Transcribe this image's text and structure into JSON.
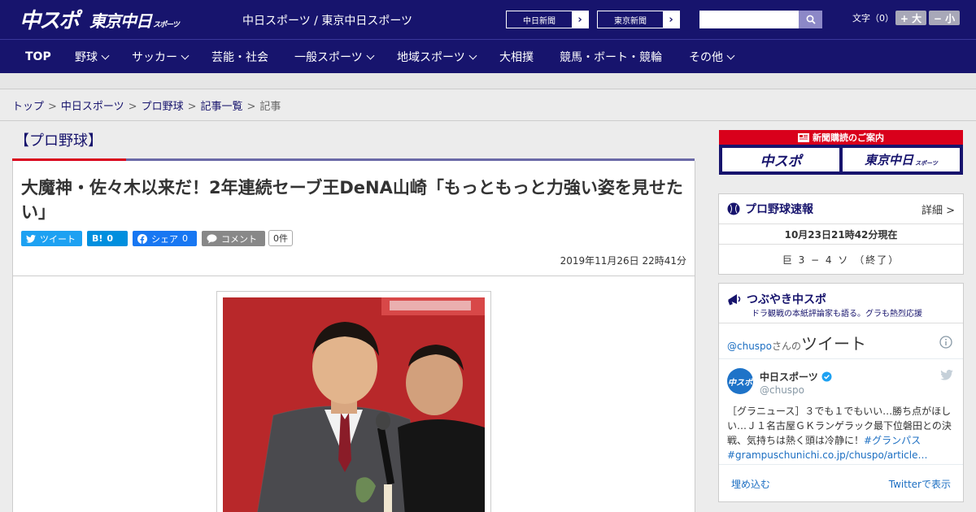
{
  "header": {
    "logo_main": "中スポ",
    "logo_tokyo": "東京中日",
    "logo_tokyo_sub": "スポーツ",
    "site_names": "中日スポーツ / 東京中日スポーツ",
    "paper_buttons": [
      "中日新聞",
      "東京新聞"
    ],
    "search_placeholder": "",
    "fontsize_label": "文字（0）",
    "fontsize_plus": "+ 大",
    "fontsize_minus": "− 小"
  },
  "nav": {
    "items": [
      {
        "label": "TOP",
        "dropdown": false
      },
      {
        "label": "野球",
        "dropdown": true
      },
      {
        "label": "サッカー",
        "dropdown": true
      },
      {
        "label": "芸能・社会",
        "dropdown": false
      },
      {
        "label": "一般スポーツ",
        "dropdown": true
      },
      {
        "label": "地域スポーツ",
        "dropdown": true
      },
      {
        "label": "大相撲",
        "dropdown": false
      },
      {
        "label": "競馬・ボート・競輪",
        "dropdown": false
      },
      {
        "label": "その他",
        "dropdown": true
      }
    ]
  },
  "breadcrumb": {
    "items": [
      "トップ",
      "中日スポーツ",
      "プロ野球",
      "記事一覧"
    ],
    "current": "記事"
  },
  "article": {
    "category": "【プロ野球】",
    "headline": "大魔神・佐々木以来だ！2年連続セーブ王DeNA山崎「もっともっと力強い姿を見せたい」",
    "share": {
      "tweet": "ツイート",
      "hatena": "B!",
      "hatena_count": "0",
      "facebook": "シェア",
      "facebook_count": "0",
      "comment": "コメント",
      "comment_count": "0件"
    },
    "date": "2019年11月26日 22時41分"
  },
  "sidebar": {
    "ad_title": "新聞購読のご案内",
    "ad_chuspo": "中スポ",
    "ad_tokyo": "東京中日",
    "ad_tokyo_sub": "スポーツ",
    "score_widget": {
      "title": "プロ野球速報",
      "detail": "詳細 >",
      "time": "10月23日21時42分現在",
      "result": "巨 3 − 4 ソ （終了）"
    },
    "twitter_widget": {
      "title": "つぶやき中スポ",
      "subtitle": "ドラ観戦の本紙評論家も語る。グラも熱烈応援",
      "handle_prefix": "@chuspo",
      "handle_suffix": "さんの",
      "tweets_label": "ツイート",
      "account_name": "中日スポーツ",
      "account_handle": "@chuspo",
      "tweet_text_plain": "［グラニュース］３でも１でもいい…勝ち点がほしい…Ｊ１名古屋ＧＫランゲラック最下位磐田との決戦、気持ちは熱く頭は冷静に！",
      "tweet_hashtag": "#グランパス",
      "tweet_link": "#grampuschunichi.co.jp/chuspo/article…",
      "embed": "埋め込む",
      "view_on": "Twitterで表示"
    }
  },
  "colors": {
    "brand": "#17146d",
    "accent_red": "#d9001b",
    "twitter": "#1da1f2",
    "facebook": "#1877f2",
    "hatena": "#008fde"
  }
}
